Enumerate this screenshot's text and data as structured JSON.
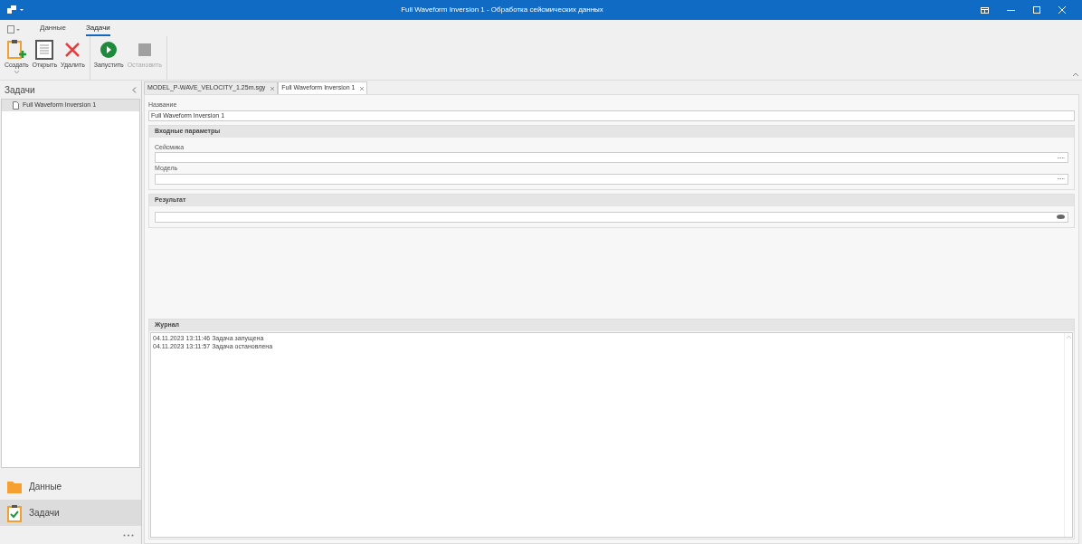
{
  "window": {
    "title": "Full Waveform Inversion 1 - Обработка сейсмических данных"
  },
  "menu_tabs": [
    {
      "label": "Данные",
      "selected": false
    },
    {
      "label": "Задачи",
      "selected": true
    }
  ],
  "ribbon": [
    {
      "groups": [
        {
          "kind": "create",
          "label": "Создать",
          "disabled": false,
          "dropdown": true
        },
        {
          "kind": "open",
          "label": "Открыть",
          "disabled": false,
          "dropdown": false
        },
        {
          "kind": "delete",
          "label": "Удалить",
          "disabled": false,
          "dropdown": false
        }
      ]
    },
    {
      "groups": [
        {
          "kind": "run",
          "label": "Запустить",
          "disabled": false,
          "dropdown": false
        },
        {
          "kind": "stop",
          "label": "Остановить",
          "disabled": true,
          "dropdown": false
        }
      ]
    }
  ],
  "sidebar": {
    "title": "Задачи",
    "items": [
      {
        "label": "Full Waveform Inversion 1",
        "selected": true
      }
    ],
    "nav": [
      {
        "kind": "folder",
        "label": "Данные",
        "selected": false
      },
      {
        "kind": "tasks",
        "label": "Задачи",
        "selected": true
      }
    ]
  },
  "doc_tabs": [
    {
      "label": "MODEL_P-WAVE_VELOCITY_1.25m.sgy",
      "selected": false
    },
    {
      "label": "Full Waveform Inversion 1",
      "selected": true
    }
  ],
  "form": {
    "name_label": "Название",
    "name_value": "Full Waveform Inversion 1",
    "sections": [
      {
        "title": "Входные параметры",
        "fields": [
          {
            "label": "Сейсмика",
            "kind": "browse"
          },
          {
            "label": "Модель",
            "kind": "browse"
          }
        ]
      },
      {
        "title": "Результат",
        "fields": [
          {
            "kind": "view"
          }
        ]
      }
    ]
  },
  "log": {
    "title": "Журнал",
    "lines": [
      "04.11.2023 13:11:46 Задача запущена",
      "04.11.2023 13:11:57 Задача остановлена"
    ]
  }
}
